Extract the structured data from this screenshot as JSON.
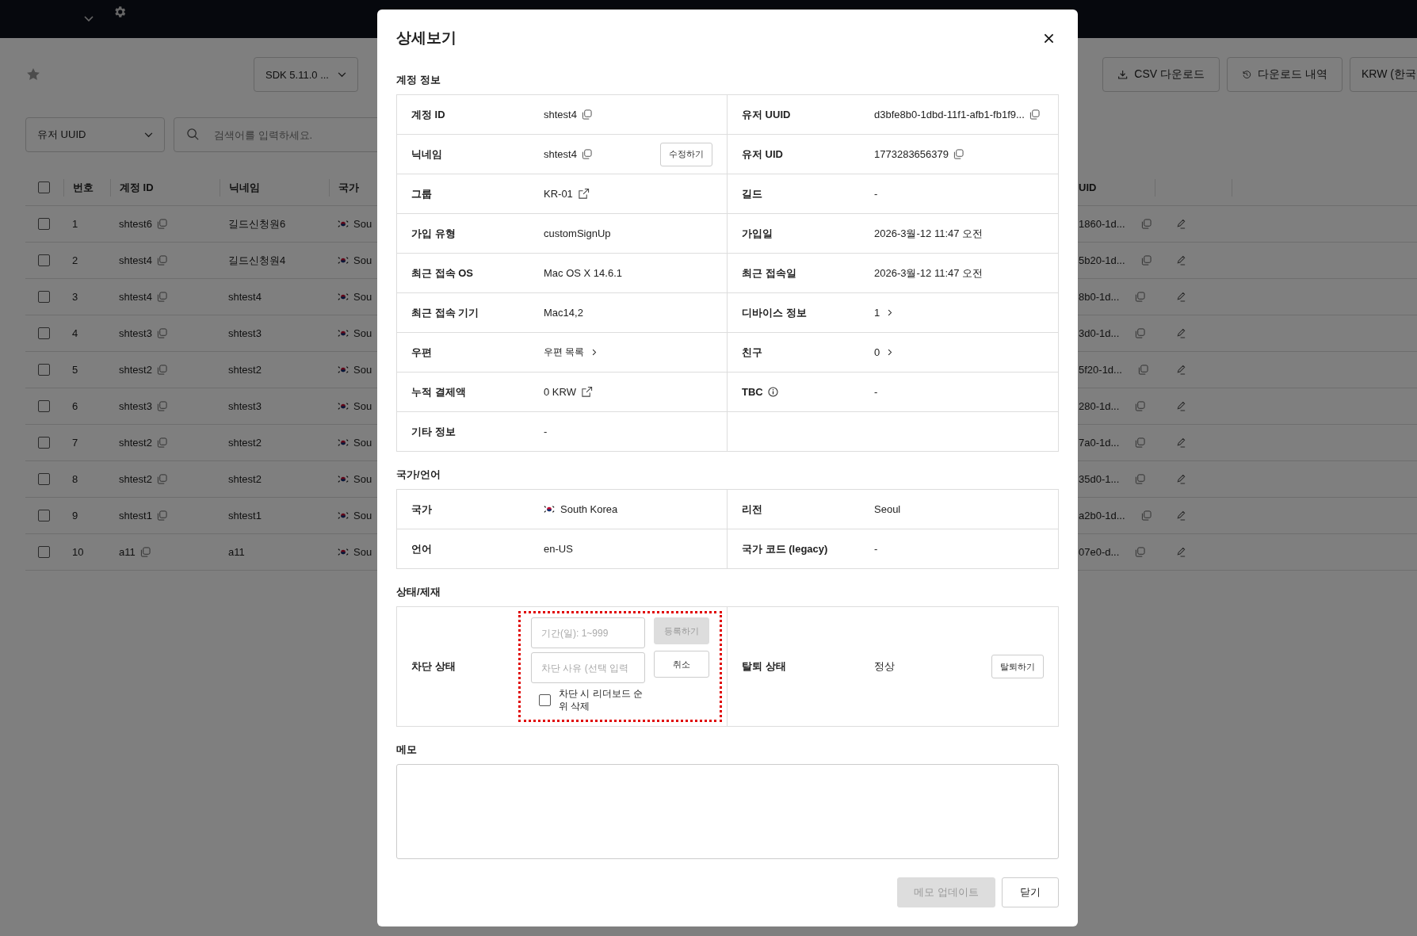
{
  "toolbar": {
    "version_select": "SDK 5.11.0 ...",
    "buttons": [
      {
        "kind": "download",
        "label": "CSV 다운로드"
      },
      {
        "kind": "history",
        "label": "다운로드 내역"
      },
      {
        "kind": "select",
        "label": "KRW (한국"
      }
    ]
  },
  "filter": {
    "field": "유저 UUID",
    "search_placeholder": "검색어를 입력하세요."
  },
  "table": {
    "header_checked": false,
    "columns": [
      "번호",
      "계정 ID",
      "닉네임",
      "국가"
    ],
    "right_column": "UID",
    "rows": [
      {
        "checked": false,
        "no": "1",
        "account_id": "shtest6",
        "nickname": "길드신청원6",
        "country": "Sou",
        "uuid": "1860-1d..."
      },
      {
        "checked": false,
        "no": "2",
        "account_id": "shtest4",
        "nickname": "길드신청원4",
        "country": "Sou",
        "uuid": "5b20-1d..."
      },
      {
        "checked": false,
        "no": "3",
        "account_id": "shtest4",
        "nickname": "shtest4",
        "country": "Sou",
        "uuid": "8b0-1d..."
      },
      {
        "checked": false,
        "no": "4",
        "account_id": "shtest3",
        "nickname": "shtest3",
        "country": "Sou",
        "uuid": "3d0-1d..."
      },
      {
        "checked": false,
        "no": "5",
        "account_id": "shtest2",
        "nickname": "shtest2",
        "country": "Sou",
        "uuid": "5f20-1d..."
      },
      {
        "checked": false,
        "no": "6",
        "account_id": "shtest3",
        "nickname": "shtest3",
        "country": "Sou",
        "uuid": "280-1d..."
      },
      {
        "checked": false,
        "no": "7",
        "account_id": "shtest2",
        "nickname": "shtest2",
        "country": "Sou",
        "uuid": "7a0-1d..."
      },
      {
        "checked": false,
        "no": "8",
        "account_id": "shtest2",
        "nickname": "shtest2",
        "country": "Sou",
        "uuid": "35d0-1..."
      },
      {
        "checked": false,
        "no": "9",
        "account_id": "shtest1",
        "nickname": "shtest1",
        "country": "Sou",
        "uuid": "a2b0-1d..."
      },
      {
        "checked": false,
        "no": "10",
        "account_id": "a11",
        "nickname": "a11",
        "country": "Sou",
        "uuid": "07e0-d..."
      }
    ]
  },
  "modal": {
    "title": "상세보기",
    "sections": [
      {
        "title": "계정 정보",
        "rows": [
          {
            "cells": [
              {
                "label": "계정 ID",
                "value": "shtest4",
                "kind": "copy"
              },
              {
                "label": "유저 UUID",
                "value": "d3bfe8b0-1dbd-11f1-afb1-fb1f9...",
                "kind": "copy"
              }
            ]
          },
          {
            "cells": [
              {
                "label": "닉네임",
                "value": "shtest4",
                "kind": "copy",
                "action": "수정하기"
              },
              {
                "label": "유저 UID",
                "value": "1773283656379",
                "kind": "copy"
              }
            ]
          },
          {
            "cells": [
              {
                "label": "그룹",
                "value": "KR-01",
                "kind": "external"
              },
              {
                "label": "길드",
                "value": "-",
                "kind": "plain"
              }
            ]
          },
          {
            "cells": [
              {
                "label": "가입 유형",
                "value": "customSignUp",
                "kind": "plain"
              },
              {
                "label": "가입일",
                "value": "2026-3월-12 11:47 오전",
                "kind": "plain"
              }
            ]
          },
          {
            "cells": [
              {
                "label": "최근 접속 OS",
                "value": "Mac OS X 14.6.1",
                "kind": "plain"
              },
              {
                "label": "최근 접속일",
                "value": "2026-3월-12 11:47 오전",
                "kind": "plain"
              }
            ]
          },
          {
            "cells": [
              {
                "label": "최근 접속 기기",
                "value": "Mac14,2",
                "kind": "plain"
              },
              {
                "label": "디바이스 정보",
                "value": "1",
                "kind": "more"
              }
            ]
          },
          {
            "cells": [
              {
                "label": "우편",
                "value": "우편 목록",
                "kind": "more"
              },
              {
                "label": "친구",
                "value": "0",
                "kind": "more"
              }
            ]
          },
          {
            "cells": [
              {
                "label": "누적 결제액",
                "value": "0 KRW",
                "kind": "external"
              },
              {
                "label": "TBC",
                "info_icon": true,
                "value": "-",
                "kind": "plain"
              }
            ]
          },
          {
            "cells": [
              {
                "label": "기타 정보",
                "value": "-",
                "kind": "plain"
              }
            ]
          }
        ]
      },
      {
        "title": "국가/언어",
        "rows": [
          {
            "cells": [
              {
                "label": "국가",
                "value": "South Korea",
                "kind": "flag"
              },
              {
                "label": "리전",
                "value": "Seoul",
                "kind": "plain"
              }
            ]
          },
          {
            "cells": [
              {
                "label": "언어",
                "value": "en-US",
                "kind": "plain"
              },
              {
                "label": "국가 코드 (legacy)",
                "value": "-",
                "kind": "plain"
              }
            ]
          }
        ]
      }
    ],
    "status": {
      "title": "상태/제재",
      "block": {
        "label": "차단 상태",
        "highlighted": true,
        "period_placeholder": "기간(일): 1~999",
        "reason_placeholder": "차단 사유 (선택 입력",
        "register": {
          "label": "등록하기",
          "disabled": true
        },
        "cancel": "취소",
        "leaderboard": {
          "label": "차단 시 리더보드 순위 삭제",
          "checked": false
        }
      },
      "withdraw": {
        "label": "탈퇴 상태",
        "value": "정상",
        "button": "탈퇴하기"
      }
    },
    "memo": {
      "title": "메모"
    },
    "footer": {
      "update": {
        "label": "메모 업데이트",
        "disabled": true
      },
      "close": "닫기"
    }
  }
}
